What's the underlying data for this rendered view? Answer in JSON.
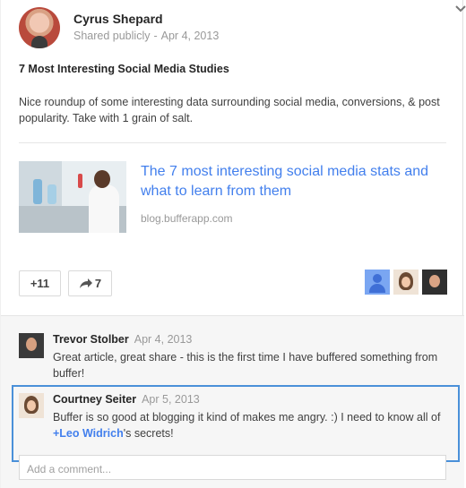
{
  "post": {
    "author": "Cyrus Shepard",
    "visibility": "Shared publicly",
    "separator": "-",
    "date": "Apr 4, 2013",
    "title": "7 Most Interesting Social Media Studies",
    "body": "Nice roundup of some interesting data surrounding social media, conversions, & post popularity. Take with 1 grain of salt."
  },
  "link": {
    "title": "The 7 most interesting social media stats and what to learn from them",
    "domain": "blog.bufferapp.com"
  },
  "actions": {
    "plus_one": "+11",
    "share_count": "7"
  },
  "comments": [
    {
      "author": "Trevor Stolber",
      "date": "Apr 4, 2013",
      "text": "Great article, great share - this is the first time I have buffered something from buffer!"
    },
    {
      "author": "Courtney Seiter",
      "date": "Apr 5, 2013",
      "text_before": "Buffer is so good at blogging it kind of makes me angry. :) I need to know all of ",
      "mention": "+Leo Widrich",
      "text_after": "'s secrets!"
    }
  ],
  "add_comment_placeholder": "Add a comment...",
  "colors": {
    "link_blue": "#427fed",
    "highlight_border": "#4a90d9",
    "muted_text": "#999999"
  },
  "icons": {
    "menu": "chevron-down-icon",
    "share": "share-arrow-icon"
  }
}
